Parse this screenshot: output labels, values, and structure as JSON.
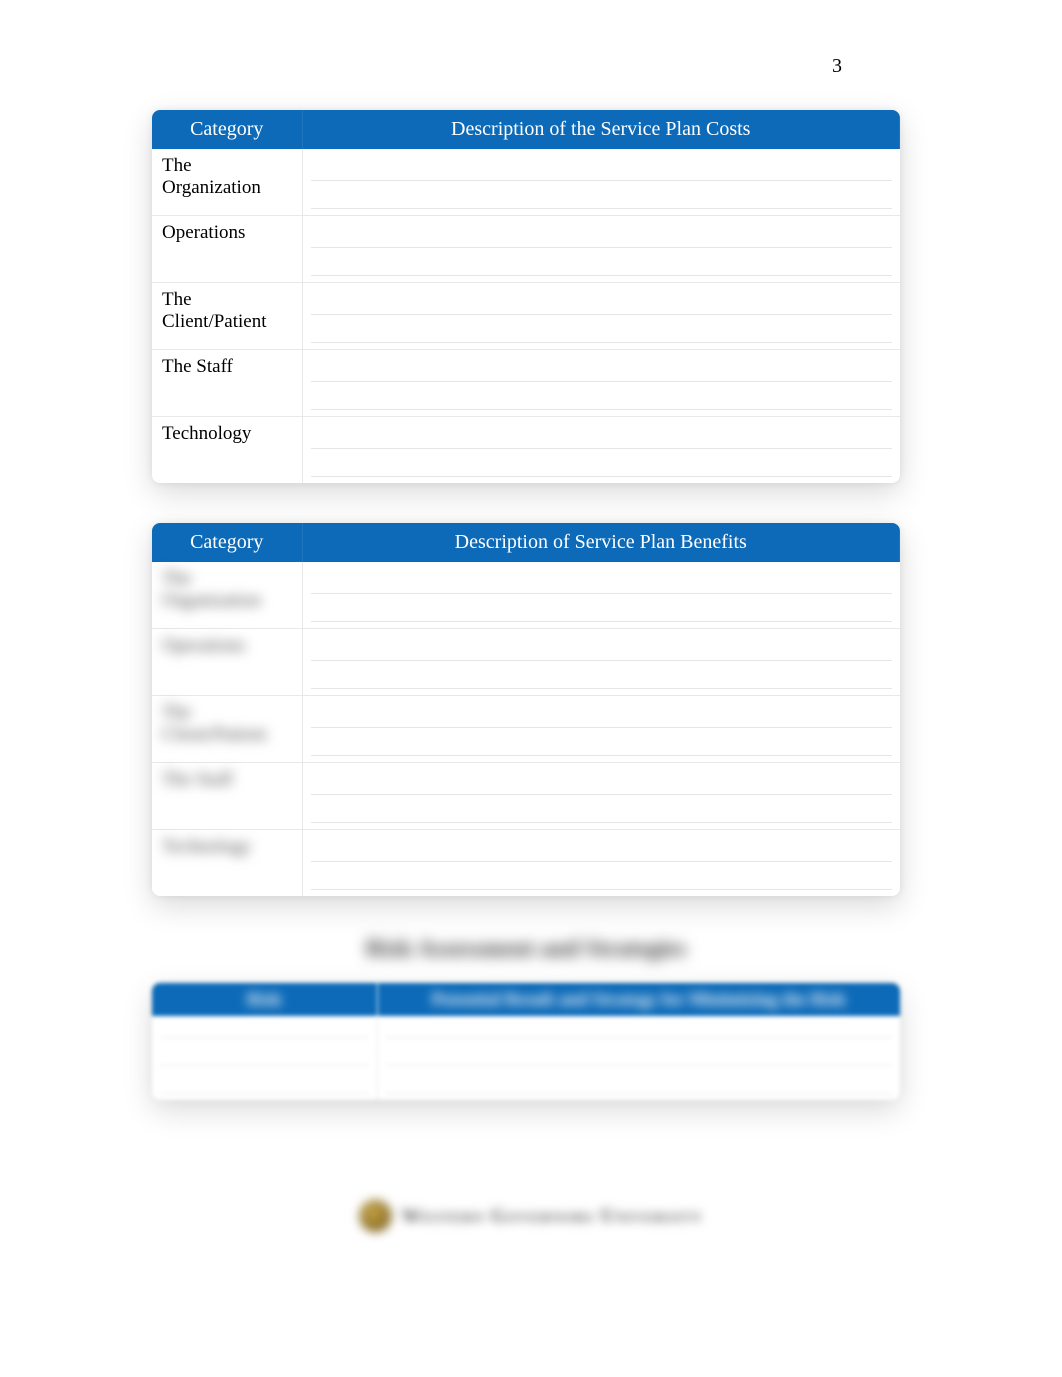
{
  "page_number": "3",
  "table1": {
    "header_category": "Category",
    "header_description": "Description of the Service Plan Costs",
    "rows": [
      {
        "category": "The Organization"
      },
      {
        "category": "Operations"
      },
      {
        "category": "The Client/Patient"
      },
      {
        "category": "The Staff"
      },
      {
        "category": "Technology"
      }
    ]
  },
  "table2": {
    "header_category": "Category",
    "header_description": "Description of Service Plan Benefits",
    "rows": [
      {
        "category": "The Organization"
      },
      {
        "category": "Operations"
      },
      {
        "category": "The Client/Patient"
      },
      {
        "category": "The Staff"
      },
      {
        "category": "Technology"
      }
    ]
  },
  "section_heading": "Risk Assessment and Strategies",
  "table3": {
    "header_a": "Risk",
    "header_b": "Potential Result and Strategy for Minimizing the Risk"
  },
  "footer": {
    "institution": "Western Governors University"
  }
}
